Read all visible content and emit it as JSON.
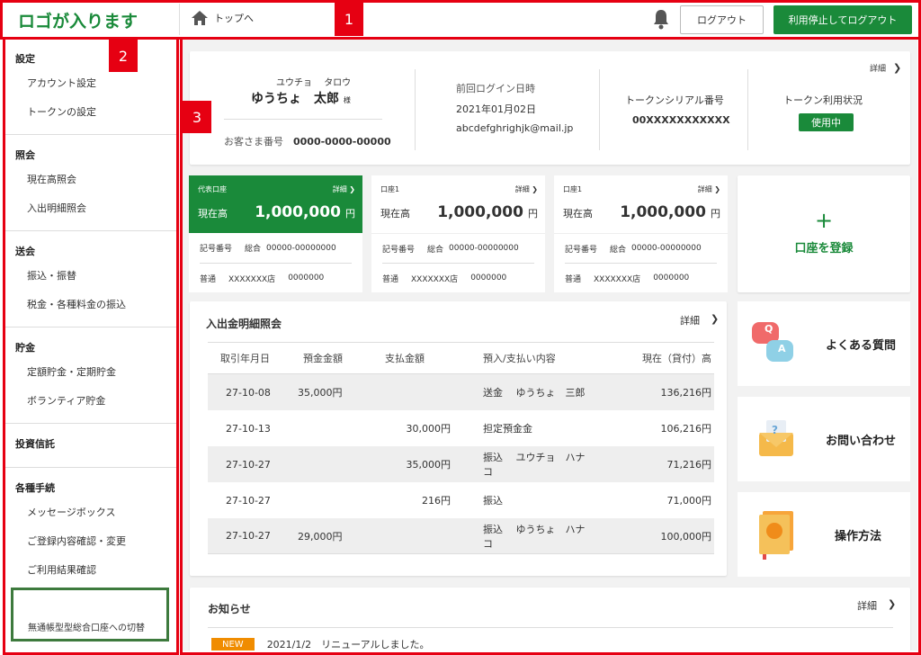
{
  "header": {
    "logo": "ロゴが入ります",
    "home_label": "トップへ",
    "logout_label": "ログアウト",
    "stop_logout_label": "利用停止してログアウト"
  },
  "annotations": {
    "n1": "1",
    "n2": "2",
    "n3": "3"
  },
  "sidebar": {
    "sections": [
      {
        "heading": "設定",
        "items": [
          "アカウント設定",
          "トークンの設定"
        ]
      },
      {
        "heading": "照会",
        "items": [
          "現在高照会",
          "入出明細照会"
        ]
      },
      {
        "heading": "送会",
        "items": [
          "振込・振替",
          "税金・各種料金の振込"
        ]
      },
      {
        "heading": "貯金",
        "items": [
          "定額貯金・定期貯金",
          "ボランティア貯金"
        ]
      },
      {
        "heading": "投資信託",
        "items": []
      },
      {
        "heading": "各種手続",
        "items": [
          "メッセージボックス",
          "ご登録内容確認・変更",
          "ご利用結果確認"
        ]
      }
    ],
    "bottom_label": "無通帳型型総合口座への切替"
  },
  "profile": {
    "kana_first": "ユウチョ",
    "kana_last": "タロウ",
    "name": "ゆうちょ　太郎",
    "honorific": "様",
    "customer_no_label": "お客さま番号",
    "customer_no": "0000-0000-00000",
    "last_login_label": "前回ログイン日時",
    "last_login_date": "2021年01月02日",
    "email": "abcdefghrighjk@mail.jp",
    "token_serial_label": "トークンシリアル番号",
    "token_serial": "00XXXXXXXXXXX",
    "token_status_label": "トークン利用状況",
    "token_status": "使用中",
    "detail_label": "詳細"
  },
  "accounts": [
    {
      "label": "代表口座",
      "detail": "詳細",
      "balance_label": "現在高",
      "balance": "1,000,000",
      "unit": "円",
      "kigo_label": "記号番号",
      "type": "総合",
      "kigo": "00000-00000000",
      "kind": "普通",
      "branch": "XXXXXXX店",
      "number": "0000000"
    },
    {
      "label": "口座1",
      "detail": "詳細",
      "balance_label": "現在高",
      "balance": "1,000,000",
      "unit": "円",
      "kigo_label": "記号番号",
      "type": "総合",
      "kigo": "00000-00000000",
      "kind": "普通",
      "branch": "XXXXXXX店",
      "number": "0000000"
    },
    {
      "label": "口座1",
      "detail": "詳細",
      "balance_label": "現在高",
      "balance": "1,000,000",
      "unit": "円",
      "kigo_label": "記号番号",
      "type": "総合",
      "kigo": "00000-00000000",
      "kind": "普通",
      "branch": "XXXXXXX店",
      "number": "0000000"
    }
  ],
  "register": {
    "plus": "+",
    "label": "口座を登録"
  },
  "transactions": {
    "title": "入出金明細照会",
    "detail": "詳細",
    "columns": [
      "取引年月日",
      "預金金額",
      "支払金額",
      "預入/支払い内容",
      "現在（貸付）高"
    ],
    "rows": [
      [
        "27-10-08",
        "35,000円",
        "",
        "送金　 ゆうちょ　三郎",
        "136,216円"
      ],
      [
        "27-10-13",
        "",
        "30,000円",
        "担定預金金",
        "106,216円"
      ],
      [
        "27-10-27",
        "",
        "35,000円",
        "振込　 ユウチョ　ハナコ",
        "71,216円"
      ],
      [
        "27-10-27",
        "",
        "216円",
        "振込",
        "71,000円"
      ],
      [
        "27-10-27",
        "29,000円",
        "",
        "振込　 ゆうちょ　ハナコ",
        "100,000円"
      ]
    ]
  },
  "side": {
    "faq": "よくある質問",
    "faq_q": "Q",
    "faq_a": "A",
    "contact": "お問い合わせ",
    "contact_q": "?",
    "howto": "操作方法"
  },
  "news": {
    "title": "お知らせ",
    "detail": "詳細",
    "badge": "NEW",
    "item": "2021/1/2　リニューアルしました。"
  },
  "colors": {
    "accent": "#1a8a3a",
    "annotation": "#e60012",
    "badge_new": "#f08c00"
  }
}
